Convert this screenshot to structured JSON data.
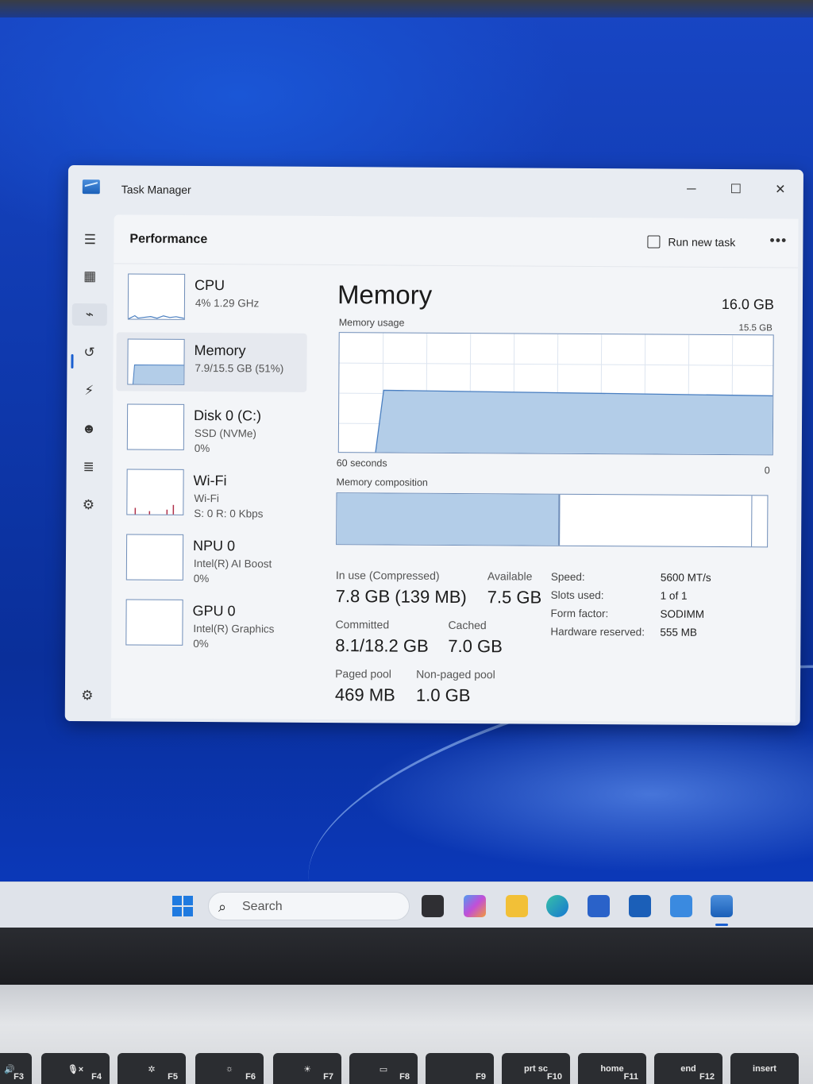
{
  "window": {
    "title": "Task Manager",
    "controls": {
      "minimize": "─",
      "maximize": "☐",
      "close": "✕"
    }
  },
  "nav": {
    "items": [
      {
        "name": "hamburger-menu-icon",
        "glyph": "☰"
      },
      {
        "name": "processes-icon",
        "glyph": "▦"
      },
      {
        "name": "performance-icon",
        "glyph": "⌁"
      },
      {
        "name": "app-history-icon",
        "glyph": "↺"
      },
      {
        "name": "startup-apps-icon",
        "glyph": "⚡"
      },
      {
        "name": "users-icon",
        "glyph": "☻"
      },
      {
        "name": "details-icon",
        "glyph": "≣"
      },
      {
        "name": "services-icon",
        "glyph": "⚙"
      }
    ],
    "settings_glyph": "⚙"
  },
  "header": {
    "title": "Performance",
    "run_new_task": "Run new task",
    "more": "•••"
  },
  "resources": [
    {
      "name": "CPU",
      "line2": "4%  1.29 GHz",
      "line3": ""
    },
    {
      "name": "Memory",
      "line2": "7.9/15.5 GB (51%)",
      "line3": ""
    },
    {
      "name": "Disk 0 (C:)",
      "line2": "SSD (NVMe)",
      "line3": "0%"
    },
    {
      "name": "Wi-Fi",
      "line2": "Wi-Fi",
      "line3": "S: 0 R: 0 Kbps"
    },
    {
      "name": "NPU 0",
      "line2": "Intel(R) AI Boost",
      "line3": "0%"
    },
    {
      "name": "GPU 0",
      "line2": "Intel(R) Graphics",
      "line3": "0%"
    }
  ],
  "memory": {
    "title": "Memory",
    "total": "16.0 GB",
    "usage_label": "Memory usage",
    "usage_max": "15.5 GB",
    "time_label": "60 seconds",
    "time_end": "0",
    "composition_label": "Memory composition",
    "in_use_label": "In use (Compressed)",
    "in_use_value": "7.8 GB (139 MB)",
    "available_label": "Available",
    "available_value": "7.5 GB",
    "committed_label": "Committed",
    "committed_value": "8.1/18.2 GB",
    "cached_label": "Cached",
    "cached_value": "7.0 GB",
    "paged_label": "Paged pool",
    "paged_value": "469 MB",
    "nonpaged_label": "Non-paged pool",
    "nonpaged_value": "1.0 GB",
    "specs": [
      {
        "label": "Speed:",
        "value": "5600 MT/s"
      },
      {
        "label": "Slots used:",
        "value": "1 of 1"
      },
      {
        "label": "Form factor:",
        "value": "SODIMM"
      },
      {
        "label": "Hardware reserved:",
        "value": "555 MB"
      }
    ]
  },
  "taskbar": {
    "search_placeholder": "Search"
  },
  "keys": [
    {
      "top": "🔊",
      "fn": "F3"
    },
    {
      "top": "🎙×",
      "fn": "F4"
    },
    {
      "top": "✲",
      "fn": "F5"
    },
    {
      "top": "☼",
      "fn": "F6"
    },
    {
      "top": "☀",
      "fn": "F7"
    },
    {
      "top": "▭",
      "fn": "F8"
    },
    {
      "top": "",
      "fn": "F9"
    },
    {
      "top": "prt sc",
      "fn": "F10"
    },
    {
      "top": "home",
      "fn": "F11"
    },
    {
      "top": "end",
      "fn": "F12"
    },
    {
      "top": "insert",
      "fn": ""
    }
  ],
  "colors": {
    "accent": "#1a5fd0",
    "graph_fill": "#b3cde8",
    "graph_border": "#6f8db8",
    "wifi_spike": "#b0304a"
  }
}
